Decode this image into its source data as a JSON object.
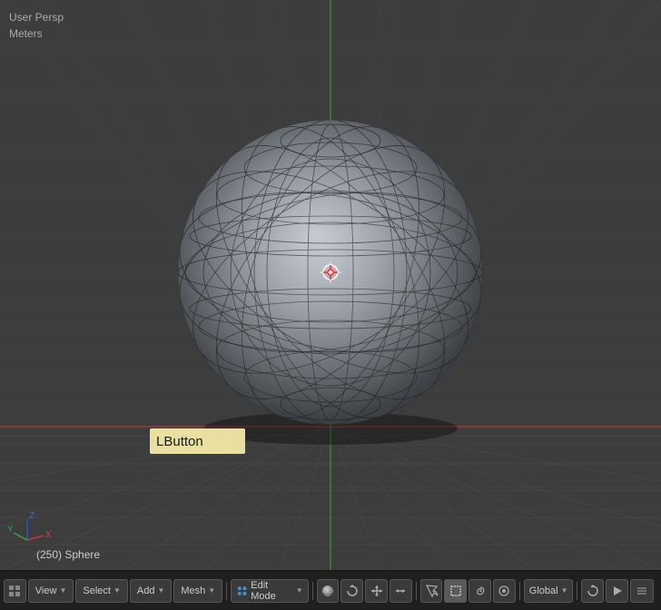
{
  "viewport": {
    "view_type": "User Persp",
    "unit": "Meters",
    "object_info": "(250) Sphere",
    "tooltip": "LButton",
    "bg_color": "#3d3d3d"
  },
  "toolbar": {
    "mode_icon": "⊞",
    "view_label": "View",
    "select_label": "Select",
    "add_label": "Add",
    "mesh_label": "Mesh",
    "mode_dropdown": "Edit Mode",
    "global_label": "Global",
    "icons": [
      "sphere",
      "rotate",
      "scale",
      "arrows",
      "cursor",
      "select-box",
      "lasso",
      "paint"
    ],
    "end_icons": [
      "⟳",
      "▷"
    ]
  },
  "axis": {
    "x_color": "#cc2222",
    "y_color": "#22aa22",
    "z_color": "#2222cc"
  }
}
